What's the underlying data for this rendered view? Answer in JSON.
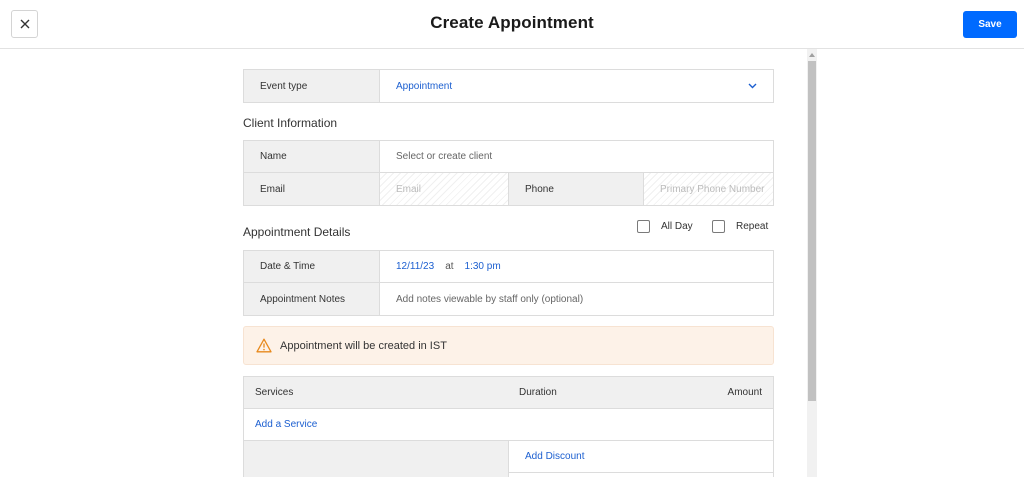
{
  "header": {
    "title": "Create Appointment",
    "save_label": "Save",
    "close_icon": "close-icon"
  },
  "event": {
    "label": "Event type",
    "value": "Appointment"
  },
  "client": {
    "title": "Client Information",
    "name_label": "Name",
    "name_placeholder": "Select or create client",
    "email_label": "Email",
    "email_placeholder": "Email",
    "phone_label": "Phone",
    "phone_placeholder": "Primary Phone Number"
  },
  "details": {
    "title": "Appointment Details",
    "all_day_label": "All Day",
    "repeat_label": "Repeat",
    "datetime_label": "Date & Time",
    "date_value": "12/11/23",
    "at_text": "at",
    "time_value": "1:30 pm",
    "notes_label": "Appointment Notes",
    "notes_placeholder": "Add notes viewable by staff only (optional)"
  },
  "alert": {
    "text": "Appointment will be created in IST",
    "icon": "warning-icon",
    "color": "#e8891c"
  },
  "services": {
    "col_services": "Services",
    "col_duration": "Duration",
    "col_amount": "Amount",
    "add_service": "Add a Service",
    "add_discount": "Add Discount"
  },
  "colors": {
    "accent": "#006aff",
    "link": "#1c5fd0",
    "alert_bg": "#fdf2e8"
  }
}
